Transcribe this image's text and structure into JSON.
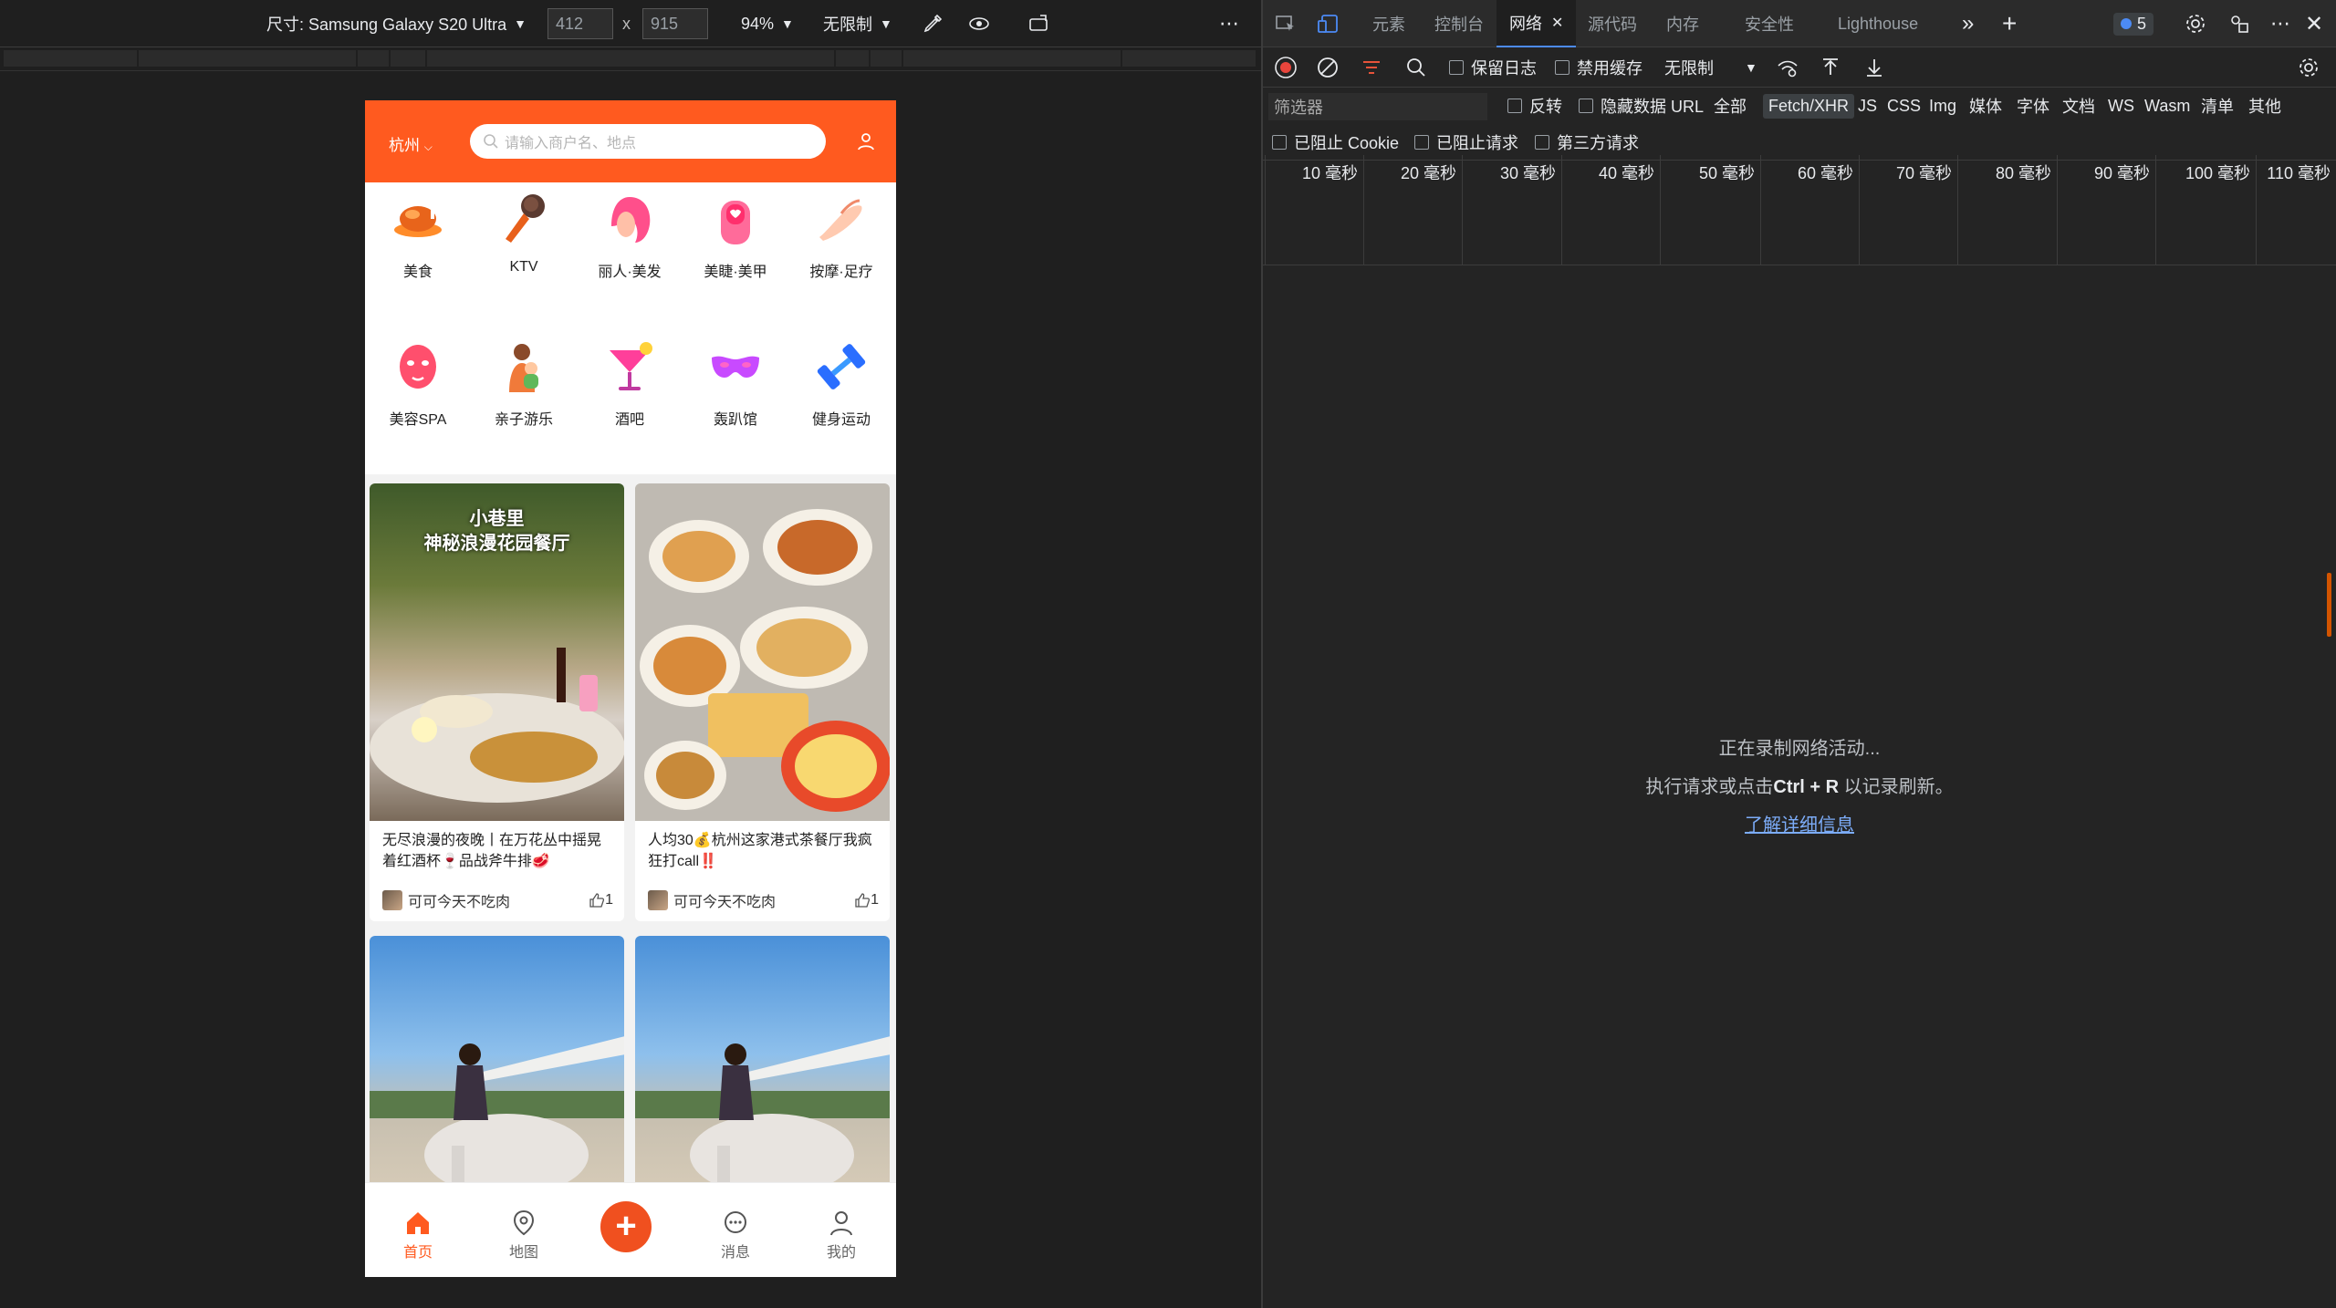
{
  "devbar": {
    "size_label": "尺寸: Samsung Galaxy S20 Ultra",
    "width": "412",
    "times": "x",
    "height": "915",
    "zoom": "94%",
    "throttle": "无限制",
    "more": "⋯"
  },
  "phone": {
    "city": "杭州",
    "search_placeholder": "请输入商户名、地点",
    "categories": [
      {
        "label": "美食",
        "icon": "roast-chicken-icon"
      },
      {
        "label": "KTV",
        "icon": "microphone-icon"
      },
      {
        "label": "丽人·美发",
        "icon": "hair-icon"
      },
      {
        "label": "美睫·美甲",
        "icon": "nail-icon"
      },
      {
        "label": "按摩·足疗",
        "icon": "massage-hand-icon"
      },
      {
        "label": "美容SPA",
        "icon": "face-mask-icon"
      },
      {
        "label": "亲子游乐",
        "icon": "parent-child-icon"
      },
      {
        "label": "酒吧",
        "icon": "cocktail-icon"
      },
      {
        "label": "轰趴馆",
        "icon": "party-mask-icon"
      },
      {
        "label": "健身运动",
        "icon": "dumbbell-icon"
      }
    ],
    "cards": [
      {
        "overlay_title": "小巷里\n神秘浪漫花园餐厅",
        "desc": "无尽浪漫的夜晚丨在万花丛中摇晃着红酒杯🍷品战斧牛排🥩",
        "author": "可可今天不吃肉",
        "likes": "1"
      },
      {
        "overlay_title": "",
        "desc": "人均30💰杭州这家港式茶餐厅我疯狂打call‼️",
        "author": "可可今天不吃肉",
        "likes": "1"
      },
      {
        "overlay_title": "",
        "desc": "",
        "author": "",
        "likes": ""
      },
      {
        "overlay_title": "",
        "desc": "",
        "author": "",
        "likes": ""
      }
    ],
    "tabs": [
      {
        "label": "首页",
        "icon": "home-icon",
        "active": true
      },
      {
        "label": "地图",
        "icon": "map-pin-icon",
        "active": false
      },
      {
        "label": "",
        "icon": "plus-icon",
        "active": false
      },
      {
        "label": "消息",
        "icon": "message-icon",
        "active": false
      },
      {
        "label": "我的",
        "icon": "profile-icon",
        "active": false
      }
    ],
    "accent": "#ff5a1f"
  },
  "devtools": {
    "tabs": [
      "元素",
      "控制台",
      "网络",
      "源代码",
      "内存",
      "安全性",
      "Lighthouse"
    ],
    "active_tab": "网络",
    "issues_count": "5",
    "toolbar": {
      "preserve_log": "保留日志",
      "disable_cache": "禁用缓存",
      "throttle": "无限制"
    },
    "filter": {
      "placeholder": "筛选器",
      "invert": "反转",
      "hide_data_urls": "隐藏数据 URL",
      "types": [
        "全部",
        "Fetch/XHR",
        "JS",
        "CSS",
        "Img",
        "媒体",
        "字体",
        "文档",
        "WS",
        "Wasm",
        "清单",
        "其他"
      ],
      "selected": "Fetch/XHR"
    },
    "row4": {
      "blocked_cookies": "已阻止 Cookie",
      "blocked_requests": "已阻止请求",
      "third_party": "第三方请求"
    },
    "timeline": [
      "10 毫秒",
      "20 毫秒",
      "30 毫秒",
      "40 毫秒",
      "50 毫秒",
      "60 毫秒",
      "70 毫秒",
      "80 毫秒",
      "90 毫秒",
      "100 毫秒",
      "110 毫秒"
    ],
    "empty": {
      "line1": "正在录制网络活动...",
      "line2_pre": "执行请求或点击",
      "line2_key": "Ctrl + R",
      "line2_post": "以记录刷新。",
      "link": "了解详细信息"
    }
  }
}
